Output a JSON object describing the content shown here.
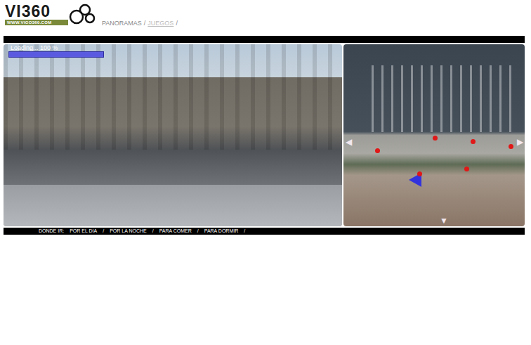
{
  "logo": {
    "name": "VI360",
    "url": "WWW.VIGO360.COM"
  },
  "nav": {
    "separator": "/",
    "items": [
      {
        "label": "PANORAMAS",
        "selected": false
      },
      {
        "label": "JUEGOS",
        "selected": true
      }
    ]
  },
  "loading": {
    "text": "Loading... 100 %",
    "level": 1
  },
  "map": {
    "pins": [
      {
        "selected": false
      },
      {
        "selected": false
      },
      {
        "selected": false
      },
      {
        "selected": false
      },
      {
        "selected": false
      },
      {
        "selected": true
      }
    ],
    "arrows": [
      "◀",
      "▶",
      "▼"
    ]
  },
  "menu": {
    "label": "DONDE IR:",
    "separator": "/",
    "items": [
      "POR EL DIA",
      "POR LA NOCHE",
      "PARA COMER",
      "PARA DORMIR"
    ]
  }
}
